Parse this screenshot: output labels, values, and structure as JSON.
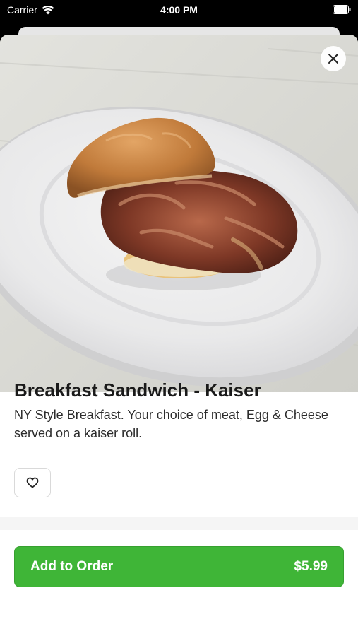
{
  "status_bar": {
    "carrier": "Carrier",
    "time": "4:00 PM"
  },
  "item": {
    "title": "Breakfast Sandwich - Kaiser",
    "description": "NY Style Breakfast.  Your choice of meat, Egg & Cheese served on a kaiser roll."
  },
  "footer": {
    "add_label": "Add to Order",
    "price": "$5.99"
  },
  "icons": {
    "close": "close-icon",
    "favorite": "heart-icon",
    "wifi": "wifi-icon",
    "battery": "battery-icon"
  },
  "colors": {
    "accent_green": "#3fb537"
  }
}
